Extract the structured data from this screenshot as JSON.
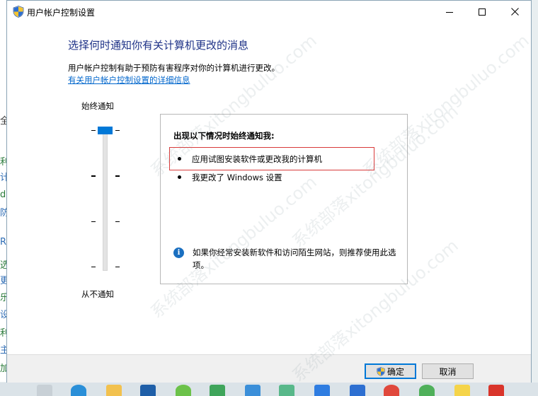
{
  "window": {
    "title": "用户帐户控制设置"
  },
  "main": {
    "heading": "选择何时通知你有关计算机更改的消息",
    "description": "用户帐户控制有助于预防有害程序对你的计算机进行更改。",
    "link_text": "有关用户帐户控制设置的详细信息"
  },
  "slider": {
    "top_label": "始终通知",
    "bottom_label": "从不通知",
    "level": 4,
    "max_level": 4
  },
  "panel": {
    "title": "出现以下情况时始终通知我:",
    "bullets": [
      "应用试图安装软件或更改我的计算机",
      "我更改了 Windows 设置"
    ],
    "info_text": "如果你经常安装新软件和访问陌生网站，则推荐使用此选项。",
    "info_icon": "info-icon"
  },
  "footer": {
    "ok_label": "确定",
    "cancel_label": "取消"
  },
  "watermark": {
    "text": "系统部落xitongbuluo.com"
  },
  "colors": {
    "heading": "#1e3287",
    "link": "#0066cc",
    "slider_thumb": "#0078d7",
    "highlight": "#d93a3a",
    "info_icon": "#1a6fc0",
    "primary_button_border": "#0078d7"
  },
  "icons": {
    "title": "uac-shield-icon",
    "minimize": "minimize-icon",
    "maximize": "maximize-icon",
    "close": "close-icon",
    "ok_button": "uac-shield-icon"
  }
}
